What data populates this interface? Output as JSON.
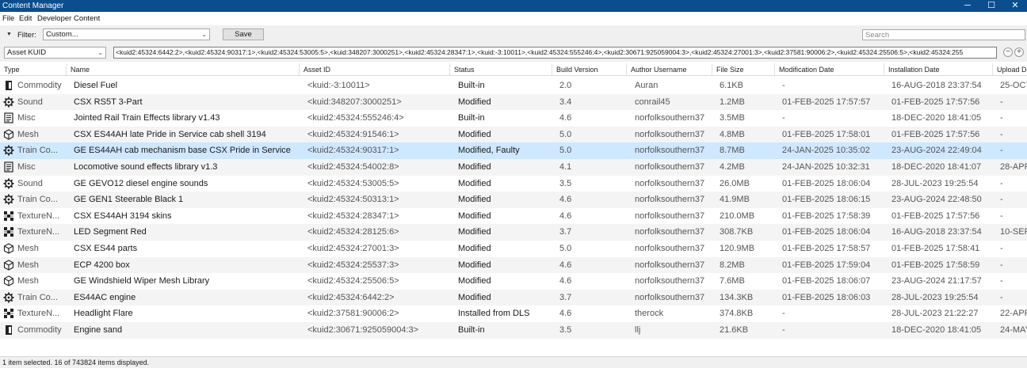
{
  "window": {
    "title": "Content Manager",
    "controls": {
      "minimize": "─",
      "maximize": "☐",
      "close": "✕"
    }
  },
  "menu": {
    "items": [
      "File",
      "Edit",
      "Developer",
      "Content"
    ]
  },
  "filter": {
    "label": "Filter:",
    "selected": "Custom...",
    "save_label": "Save",
    "search_placeholder": "Search"
  },
  "kuid_bar": {
    "field_selected": "Asset KUID",
    "query": "<kuid2:45324:6442:2>,<kuid2:45324:90317:1>,<kuid2:45324:53005:5>,<kuid:348207:3000251>,<kuid2:45324:28347:1>,<kuid:-3:10011>,<kuid2:45324:555246:4>,<kuid2:30671:925059004:3>,<kuid2:45324:27001:3>,<kuid2:37581:90006:2>,<kuid2:45324:25506:5>,<kuid2:45324:255",
    "remove_label": "−",
    "add_label": "+"
  },
  "table": {
    "columns": [
      "Type",
      "Name",
      "Asset ID",
      "Status",
      "Build Version",
      "Author Username",
      "File Size",
      "Modification Date",
      "Installation Date",
      "Upload Da"
    ],
    "rows": [
      {
        "icon": "commodity-icon",
        "type": "Commodity",
        "name": "Diesel Fuel",
        "asset_id": "<kuid:-3:10011>",
        "status": "Built-in",
        "build": "2.0",
        "author": "Auran",
        "size": "6.1KB",
        "modified": "-",
        "installed": "16-AUG-2018 23:37:54",
        "uploaded": "25-OCT"
      },
      {
        "icon": "gear-icon",
        "type": "Sound",
        "name": "CSX RS5T 3-Part",
        "asset_id": "<kuid:348207:3000251>",
        "status": "Modified",
        "build": "3.4",
        "author": "conrail45",
        "size": "1.2MB",
        "modified": "01-FEB-2025 17:57:57",
        "installed": "01-FEB-2025 17:57:56",
        "uploaded": "-"
      },
      {
        "icon": "document-icon",
        "type": "Misc",
        "name": "Jointed Rail Train Effects library v1.43",
        "asset_id": "<kuid2:45324:555246:4>",
        "status": "Built-in",
        "build": "4.6",
        "author": "norfolksouthern37",
        "size": "3.5MB",
        "modified": "-",
        "installed": "18-DEC-2020 18:41:05",
        "uploaded": "-"
      },
      {
        "icon": "cube-icon",
        "type": "Mesh",
        "name": "CSX ES44AH late Pride in Service cab shell 3194",
        "asset_id": "<kuid2:45324:91546:1>",
        "status": "Modified",
        "build": "5.0",
        "author": "norfolksouthern37",
        "size": "4.8MB",
        "modified": "01-FEB-2025 17:58:01",
        "installed": "01-FEB-2025 17:57:56",
        "uploaded": "-"
      },
      {
        "icon": "gear-icon",
        "type": "Train Co...",
        "name": "GE ES44AH cab mechanism base CSX Pride in Service",
        "asset_id": "<kuid2:45324:90317:1>",
        "status": "Modified, Faulty",
        "build": "5.0",
        "author": "norfolksouthern37",
        "size": "8.7MB",
        "modified": "24-JAN-2025 10:35:02",
        "installed": "23-AUG-2024 22:49:04",
        "uploaded": "-"
      },
      {
        "icon": "document-icon",
        "type": "Misc",
        "name": "Locomotive sound effects library v1.3",
        "asset_id": "<kuid2:45324:54002:8>",
        "status": "Modified",
        "build": "4.1",
        "author": "norfolksouthern37",
        "size": "4.2MB",
        "modified": "24-JAN-2025 10:32:31",
        "installed": "18-DEC-2020 18:41:07",
        "uploaded": "28-APR"
      },
      {
        "icon": "gear-icon",
        "type": "Sound",
        "name": "GE GEVO12 diesel engine sounds",
        "asset_id": "<kuid2:45324:53005:5>",
        "status": "Modified",
        "build": "3.5",
        "author": "norfolksouthern37",
        "size": "26.0MB",
        "modified": "01-FEB-2025 18:06:04",
        "installed": "28-JUL-2023 19:25:54",
        "uploaded": "-"
      },
      {
        "icon": "gear-icon",
        "type": "Train Co...",
        "name": "GE GEN1 Steerable Black 1",
        "asset_id": "<kuid2:45324:50313:1>",
        "status": "Modified",
        "build": "4.6",
        "author": "norfolksouthern37",
        "size": "41.9MB",
        "modified": "01-FEB-2025 18:06:15",
        "installed": "23-AUG-2024 22:48:50",
        "uploaded": "-"
      },
      {
        "icon": "texture-icon",
        "type": "TextureN...",
        "name": "CSX ES44AH 3194 skins",
        "asset_id": "<kuid2:45324:28347:1>",
        "status": "Modified",
        "build": "4.6",
        "author": "norfolksouthern37",
        "size": "210.0MB",
        "modified": "01-FEB-2025 17:58:39",
        "installed": "01-FEB-2025 17:57:56",
        "uploaded": "-"
      },
      {
        "icon": "texture-icon",
        "type": "TextureN...",
        "name": "LED Segment Red",
        "asset_id": "<kuid2:45324:28125:6>",
        "status": "Modified",
        "build": "3.7",
        "author": "norfolksouthern37",
        "size": "308.7KB",
        "modified": "01-FEB-2025 18:06:04",
        "installed": "16-AUG-2018 23:37:54",
        "uploaded": "10-SEP"
      },
      {
        "icon": "cube-icon",
        "type": "Mesh",
        "name": "CSX ES44 parts",
        "asset_id": "<kuid2:45324:27001:3>",
        "status": "Modified",
        "build": "5.0",
        "author": "norfolksouthern37",
        "size": "120.9MB",
        "modified": "01-FEB-2025 17:58:57",
        "installed": "01-FEB-2025 17:58:41",
        "uploaded": "-"
      },
      {
        "icon": "cube-icon",
        "type": "Mesh",
        "name": "ECP 4200 box",
        "asset_id": "<kuid2:45324:25537:3>",
        "status": "Modified",
        "build": "4.6",
        "author": "norfolksouthern37",
        "size": "8.2MB",
        "modified": "01-FEB-2025 17:59:04",
        "installed": "01-FEB-2025 17:58:59",
        "uploaded": "-"
      },
      {
        "icon": "cube-icon",
        "type": "Mesh",
        "name": "GE Windshield Wiper Mesh Library",
        "asset_id": "<kuid2:45324:25506:5>",
        "status": "Modified",
        "build": "4.6",
        "author": "norfolksouthern37",
        "size": "7.6MB",
        "modified": "01-FEB-2025 18:06:07",
        "installed": "23-AUG-2024 21:17:57",
        "uploaded": "-"
      },
      {
        "icon": "gear-icon",
        "type": "Train Co...",
        "name": "ES44AC engine",
        "asset_id": "<kuid2:45324:6442:2>",
        "status": "Modified",
        "build": "3.7",
        "author": "norfolksouthern37",
        "size": "134.3KB",
        "modified": "01-FEB-2025 18:06:03",
        "installed": "28-JUL-2023 19:25:54",
        "uploaded": "-"
      },
      {
        "icon": "texture-icon",
        "type": "TextureN...",
        "name": "Headlight Flare",
        "asset_id": "<kuid2:37581:90006:2>",
        "status": "Installed from DLS",
        "build": "4.6",
        "author": "therock",
        "size": "374.8KB",
        "modified": "-",
        "installed": "28-JUL-2023 21:22:27",
        "uploaded": "22-APR"
      },
      {
        "icon": "commodity-icon",
        "type": "Commodity",
        "name": "Engine sand",
        "asset_id": "<kuid2:30671:925059004:3>",
        "status": "Built-in",
        "build": "3.5",
        "author": "llj",
        "size": "21.6KB",
        "modified": "-",
        "installed": "18-DEC-2020 18:41:05",
        "uploaded": "24-MAY"
      }
    ]
  },
  "selected_row": 4,
  "status_bar": {
    "text": "1 item selected. 16 of 743824 items displayed."
  },
  "colors": {
    "titlebar": "#0b4e8e",
    "selection": "#cde8ff"
  }
}
